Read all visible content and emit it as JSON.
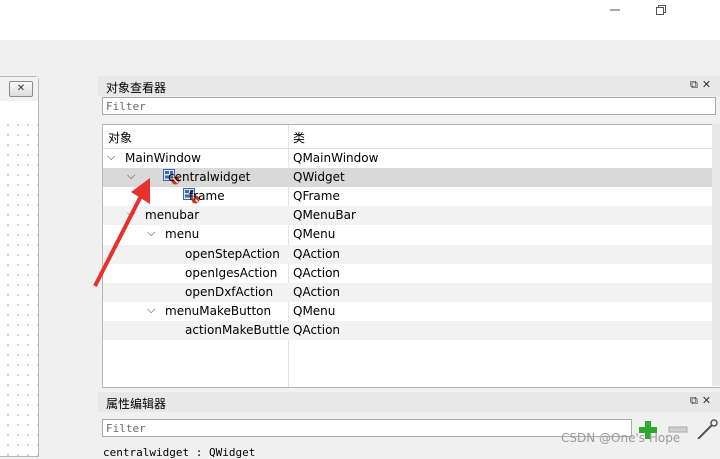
{
  "window": {
    "minimize_icon": "minimize-icon",
    "restore_icon": "restore-icon"
  },
  "form_editor": {
    "close_glyph": "✕"
  },
  "object_inspector": {
    "title": "对象查看器",
    "filter_placeholder": "Filter",
    "columns": {
      "object": "对象",
      "class": "类"
    },
    "rows": [
      {
        "name": "MainWindow",
        "class": "QMainWindow",
        "level": 0,
        "expander": "expanded",
        "icon": ""
      },
      {
        "name": "centralwidget",
        "class": "QWidget",
        "level": 1,
        "expander": "expanded",
        "icon": "layout-widget-icon",
        "selected": true
      },
      {
        "name": "frame",
        "class": "QFrame",
        "level": 2,
        "expander": "none",
        "icon": "layout-widget-icon"
      },
      {
        "name": "menubar",
        "class": "QMenuBar",
        "level": 1,
        "expander": "expanded",
        "icon": ""
      },
      {
        "name": "menu",
        "class": "QMenu",
        "level": 2,
        "expander": "expanded",
        "icon": ""
      },
      {
        "name": "openStepAction",
        "class": "QAction",
        "level": 3,
        "expander": "none",
        "icon": ""
      },
      {
        "name": "openIgesAction",
        "class": "QAction",
        "level": 3,
        "expander": "none",
        "icon": ""
      },
      {
        "name": "openDxfAction",
        "class": "QAction",
        "level": 3,
        "expander": "none",
        "icon": ""
      },
      {
        "name": "menuMakeButton",
        "class": "QMenu",
        "level": 2,
        "expander": "expanded",
        "icon": ""
      },
      {
        "name": "actionMakeButtle",
        "class": "QAction",
        "level": 3,
        "expander": "none",
        "icon": ""
      }
    ]
  },
  "property_editor": {
    "title": "属性编辑器",
    "filter_placeholder": "Filter",
    "current_object": "centralwidget : QWidget"
  },
  "watermark": "CSDN @One's Hope",
  "colors": {
    "annotation_arrow": "#e8312a",
    "add_icon": "#2ea82e"
  }
}
